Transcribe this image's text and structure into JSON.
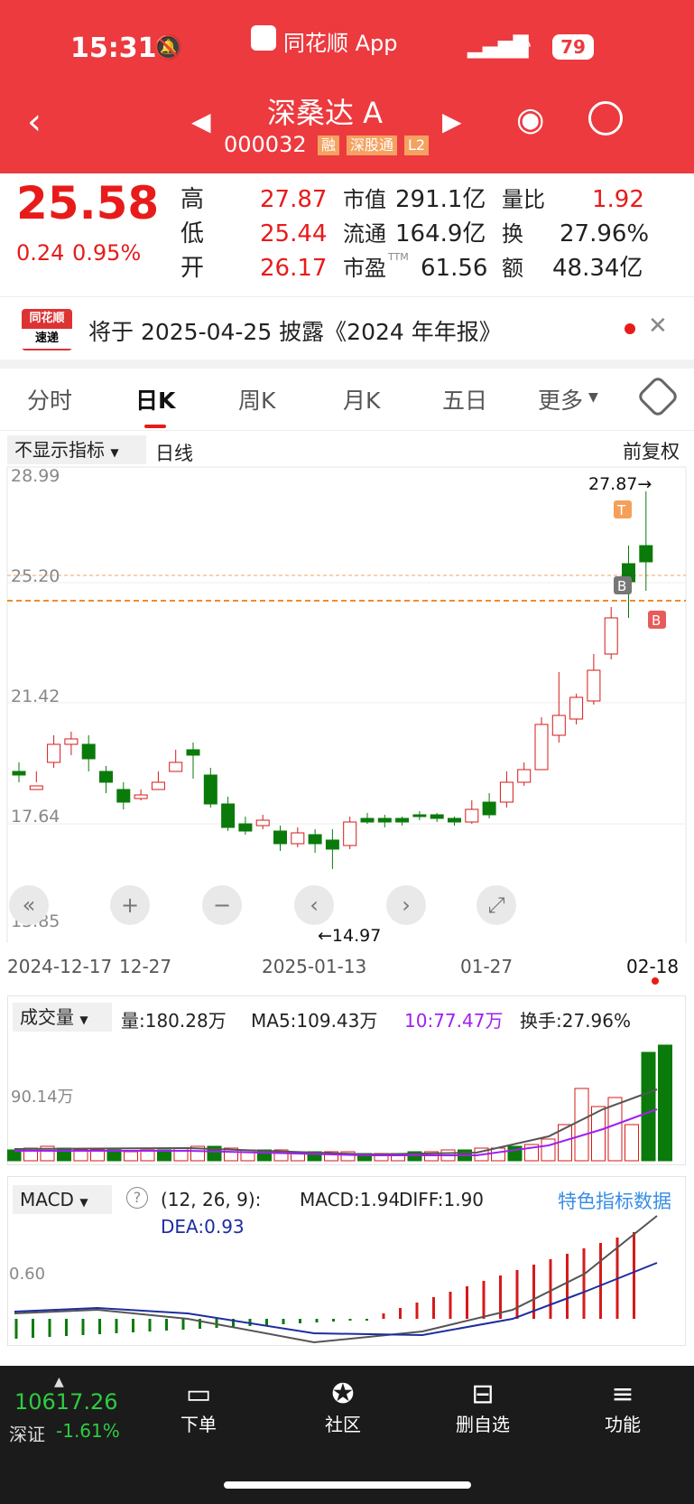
{
  "status": {
    "time": "15:31",
    "app": "同花顺 App",
    "battery": "79"
  },
  "header": {
    "name": "深桑达 A",
    "code": "000032",
    "badges": [
      "融",
      "深股通",
      "L2"
    ]
  },
  "quote": {
    "price": "25.58",
    "change": "0.24",
    "pct": "0.95%",
    "high_label": "高",
    "high": "27.87",
    "low_label": "低",
    "low": "25.44",
    "open_label": "开",
    "open": "26.17",
    "mcap_label": "市值",
    "mcap": "291.1亿",
    "float_label": "流通",
    "float": "164.9亿",
    "pe_label": "市盈",
    "pe_sup": "TTM",
    "pe": "61.56",
    "vr_label": "量比",
    "vr": "1.92",
    "turn_label": "换",
    "turn": "27.96%",
    "amt_label": "额",
    "amt": "48.34亿"
  },
  "news": {
    "logo_line1": "同花顺",
    "logo_line2": "速递",
    "text": "将于 2025-04-25 披露《2024 年年报》"
  },
  "tabs": [
    "分时",
    "日K",
    "周K",
    "月K",
    "五日",
    "更多"
  ],
  "toolbar": {
    "indicator": "不显示指标",
    "period": "日线",
    "adjust": "前复权"
  },
  "price_axis": [
    "28.99",
    "25.20",
    "21.42",
    "17.64",
    "13.85"
  ],
  "max_label": "27.87→",
  "min_label": "←14.97",
  "dates": [
    "2024-12-17",
    "12-27",
    "2025-01-13",
    "01-27",
    "02-18"
  ],
  "volume": {
    "selector": "成交量",
    "vol": "量:180.28万",
    "ma5": "MA5:109.43万",
    "ma10": "10:77.47万",
    "turnover": "换手:27.96%",
    "axis": "90.14万"
  },
  "macd": {
    "selector": "MACD",
    "params": "(12, 26, 9):",
    "macd": "MACD:1.94",
    "diff": "DIFF:1.90",
    "dea": "DEA:0.93",
    "link": "特色指标数据",
    "axis": "0.60"
  },
  "bottom": {
    "index_value": "10617.26",
    "index_name": "深证",
    "index_pct": "-1.61%",
    "items": [
      "下单",
      "社区",
      "删自选",
      "功能"
    ]
  },
  "colors": {
    "brand": "#ec3a3f",
    "up": "#e81b1b",
    "down": "#0a7a0a",
    "link": "#3a8ee6"
  }
}
